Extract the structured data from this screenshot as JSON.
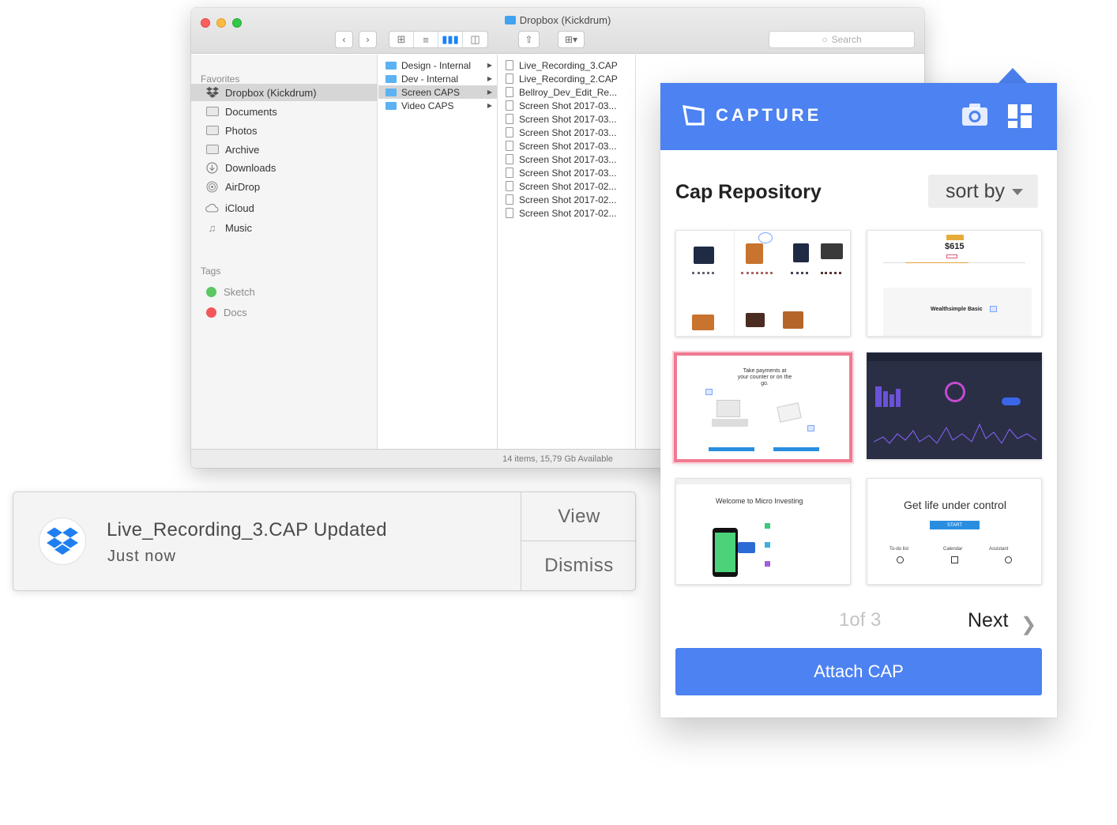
{
  "finder": {
    "title": "Dropbox (Kickdrum)",
    "search_placeholder": "Search",
    "sidebar": {
      "favorites_heading": "Favorites",
      "items": [
        {
          "label": "Dropbox (Kickdrum)",
          "icon": "dropbox-icon"
        },
        {
          "label": "Documents",
          "icon": "folder-icon"
        },
        {
          "label": "Photos",
          "icon": "folder-icon"
        },
        {
          "label": "Archive",
          "icon": "folder-icon"
        },
        {
          "label": "Downloads",
          "icon": "download-icon"
        },
        {
          "label": "AirDrop",
          "icon": "airdrop-icon"
        },
        {
          "label": "iCloud",
          "icon": "cloud-icon"
        },
        {
          "label": "Music",
          "icon": "music-icon"
        }
      ],
      "tags_heading": "Tags",
      "tags": [
        {
          "label": "Sketch",
          "color": "#5cc763"
        },
        {
          "label": "Docs",
          "color": "#f2575a"
        }
      ]
    },
    "folders": [
      "Design - Internal",
      "Dev - Internal",
      "Screen CAPS",
      "Video CAPS"
    ],
    "files": [
      "Live_Recording_3.CAP",
      "Live_Recording_2.CAP",
      "Bellroy_Dev_Edit_Re...",
      "Screen Shot 2017-03...",
      "Screen Shot 2017-03...",
      "Screen Shot 2017-03...",
      "Screen Shot 2017-03...",
      "Screen Shot 2017-03...",
      "Screen Shot 2017-03...",
      "Screen Shot 2017-02...",
      "Screen Shot 2017-02...",
      "Screen Shot 2017-02..."
    ],
    "status": "14 items, 15,79 Gb Available"
  },
  "notification": {
    "title": "Live_Recording_3.CAP Updated",
    "time": "Just now",
    "view_label": "View",
    "dismiss_label": "Dismiss",
    "icon": "dropbox-icon"
  },
  "capture": {
    "brand": "CAPTURE",
    "accent": "#4c82f1",
    "repo_title": "Cap Repository",
    "sort_label": "sort by",
    "pager": "1of 3",
    "next_label": "Next",
    "attach_label": "Attach CAP",
    "thumbs": {
      "t2_price": "$615",
      "t2_plan": "Wealthsimple Basic",
      "t3_heading": "Take payments at your counter or on the go.",
      "t5_heading": "Welcome to Micro Investing",
      "t6_heading": "Get life under control",
      "t6_button": "START",
      "t6_cols": [
        "To-do list",
        "Calendar",
        "Assistant"
      ]
    }
  }
}
